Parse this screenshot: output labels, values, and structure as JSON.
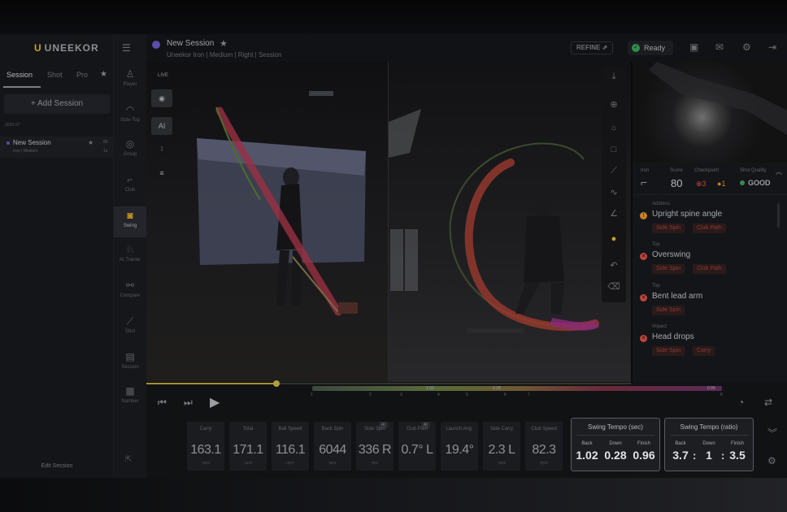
{
  "app": {
    "logo": "UNEEKOR"
  },
  "left_panel": {
    "tabs": [
      "Session",
      "Shot",
      "Pro"
    ],
    "add_session": "+ Add Session",
    "date_group": "2025-07",
    "session": {
      "title": "New Session",
      "sub": "Iron | Medium",
      "n1": "85",
      "n2": "1s"
    },
    "edit_session": "Edit Session"
  },
  "nav": {
    "items": [
      {
        "label": "Player",
        "icon": "player-icon"
      },
      {
        "label": "Side-Top",
        "icon": "side-top-icon"
      },
      {
        "label": "Group",
        "icon": "group-icon"
      },
      {
        "label": "Club",
        "icon": "club-icon"
      },
      {
        "label": "Swing",
        "icon": "camera-icon",
        "active": true
      },
      {
        "label": "AI Trainer",
        "icon": "ai-trainer-icon"
      },
      {
        "label": "Compare",
        "icon": "compare-icon"
      },
      {
        "label": "Shot",
        "icon": "shot-icon"
      },
      {
        "label": "Session",
        "icon": "session-icon"
      },
      {
        "label": "Number",
        "icon": "number-icon"
      }
    ]
  },
  "header": {
    "title": "New Session",
    "subtitle": "Uneekor  Iron | Medium | Right | Session",
    "refine": "REFINE",
    "status": "Ready"
  },
  "video": {
    "live": "LIVE",
    "ai_label": "AI"
  },
  "analysis": {
    "club_label": "Iron",
    "score_label": "Score",
    "score": "80",
    "checkpoint_label": "Checkpoint",
    "checkpoint_red": "3",
    "checkpoint_orange": "1",
    "quality_label": "Shot Quality",
    "quality": "GOOD",
    "issues": [
      {
        "stage": "Address",
        "title": "Upright spine angle",
        "tags": [
          "Side Spin",
          "Club Path"
        ],
        "severity": "warning"
      },
      {
        "stage": "Top",
        "title": "Overswing",
        "tags": [
          "Side Spin",
          "Club Path"
        ],
        "severity": "error"
      },
      {
        "stage": "Top",
        "title": "Bent lead arm",
        "tags": [
          "Side Spin"
        ],
        "severity": "error"
      },
      {
        "stage": "Impact",
        "title": "Head drops",
        "tags": [
          "Side Spin",
          "Carry"
        ],
        "severity": "error"
      }
    ]
  },
  "timeline": {
    "markers": [
      "1",
      "2",
      "3",
      "4",
      "5",
      "6",
      "7",
      "8"
    ],
    "values": [
      "1.02",
      "0.28",
      "0.96"
    ]
  },
  "metrics": [
    {
      "label": "Carry",
      "value": "163.1",
      "unit": "yard"
    },
    {
      "label": "Total",
      "value": "171.1",
      "unit": "yard"
    },
    {
      "label": "Ball Speed",
      "value": "116.1",
      "unit": "mph"
    },
    {
      "label": "Back Spin",
      "value": "6044",
      "unit": "rpm"
    },
    {
      "label": "Side Spin",
      "value": "336 R",
      "unit": "rpm",
      "badge": "AI"
    },
    {
      "label": "Club Path",
      "value": "0.7° L",
      "unit": "",
      "badge": "AI"
    },
    {
      "label": "Launch Ang.",
      "value": "19.4°",
      "unit": ""
    },
    {
      "label": "Side Carry",
      "value": "2.3 L",
      "unit": "yard"
    },
    {
      "label": "Club Speed",
      "value": "82.3",
      "unit": "mph"
    }
  ],
  "tempo_sec": {
    "title": "Swing Tempo (sec)",
    "labels": [
      "Back",
      "Down",
      "Finish"
    ],
    "values": [
      "1.02",
      "0.28",
      "0.96"
    ]
  },
  "tempo_ratio": {
    "title": "Swing Tempo (ratio)",
    "labels": [
      "Back",
      "Down",
      "Finish"
    ],
    "values": [
      "3.7",
      "1",
      "3.5"
    ]
  },
  "colors": {
    "accent": "#c9a227",
    "error": "#c2453c",
    "warning": "#c97f24",
    "good": "#2f8f4a"
  }
}
